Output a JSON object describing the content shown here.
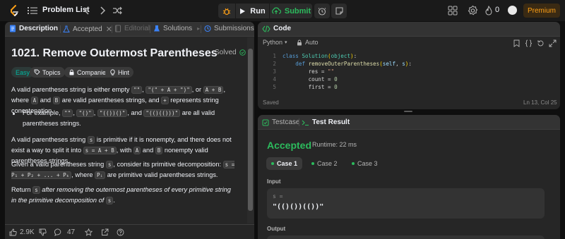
{
  "topbar": {
    "problem_list_label": "Problem List",
    "run_label": "Run",
    "submit_label": "Submit",
    "streak_count": "0",
    "premium_label": "Premium"
  },
  "left_tabs": {
    "description": "Description",
    "accepted": "Accepted",
    "editorial": "Editorial",
    "solutions": "Solutions",
    "submissions": "Submissions"
  },
  "problem": {
    "title": "1021. Remove Outermost Parentheses",
    "solved_label": "Solved",
    "difficulty": "Easy",
    "topics_label": "Topics",
    "companies_label": "Companies",
    "hint_label": "Hint",
    "p1": {
      "t1": "A valid parentheses string is either empty ",
      "c1": "\"\"",
      "t2": ", ",
      "c2": "\"(\" + A + \")\"",
      "t3": ", or ",
      "c3": "A + B",
      "t4": ", where ",
      "c4": "A",
      "t5": " and ",
      "c5": "B",
      "t6": " are valid parentheses strings, and ",
      "c6": "+",
      "t7": " represents string concatenation."
    },
    "bullet": {
      "t1": "For example, ",
      "c1": "\"\"",
      "t2": ", ",
      "c2": "\"()\"",
      "t3": ", ",
      "c3": "\"(())()\"",
      "t4": ", and ",
      "c4": "\"(()(()))\"",
      "t5": " are all valid parentheses strings."
    },
    "p2": {
      "t1": "A valid parentheses string ",
      "c1": "s",
      "t2": " is primitive if it is nonempty, and there does not exist a way to split it into ",
      "c2": "s = A + B",
      "t3": ", with ",
      "c3": "A",
      "t4": " and ",
      "c4": "B",
      "t5": " nonempty valid parentheses strings."
    },
    "p3": {
      "t1": "Given a valid parentheses string ",
      "c1": "s",
      "t2": ", consider its primitive decomposition: ",
      "c2": "s = P₁ + P₂ + ... + Pₖ",
      "t3": ", where ",
      "c3": "Pᵢ",
      "t4": " are primitive valid parentheses strings."
    },
    "p4": {
      "t1": "Return ",
      "c1": "s",
      "t2": " after removing the outermost parentheses of every primitive string in the primitive decomposition of ",
      "c2": "s",
      "t3": "."
    },
    "likes": "2.9K",
    "comments": "47"
  },
  "code": {
    "title": "Code",
    "language": "Python",
    "mode": "Auto",
    "lines": [
      {
        "n": "1",
        "text": "class Solution(object):"
      },
      {
        "n": "2",
        "text": "    def removeOuterParentheses(self, s):"
      },
      {
        "n": "3",
        "text": "        res = \"\""
      },
      {
        "n": "4",
        "text": "        count = 0"
      },
      {
        "n": "5",
        "text": "        first = 0"
      }
    ],
    "status": "Saved",
    "cursor": "Ln 13, Col 25"
  },
  "test": {
    "testcase_tab": "Testcase",
    "result_tab": "Test Result",
    "verdict": "Accepted",
    "runtime": "Runtime: 22 ms",
    "cases": [
      "Case 1",
      "Case 2",
      "Case 3"
    ],
    "input_label": "Input",
    "input_var": "s =",
    "input_value": "\"(()())(())\"",
    "output_label": "Output"
  },
  "colors": {
    "accent": "#ffa116",
    "success": "#2cbb5d",
    "easy": "#00b8a3",
    "bg": "#0f0f0f",
    "panel": "#262626"
  }
}
